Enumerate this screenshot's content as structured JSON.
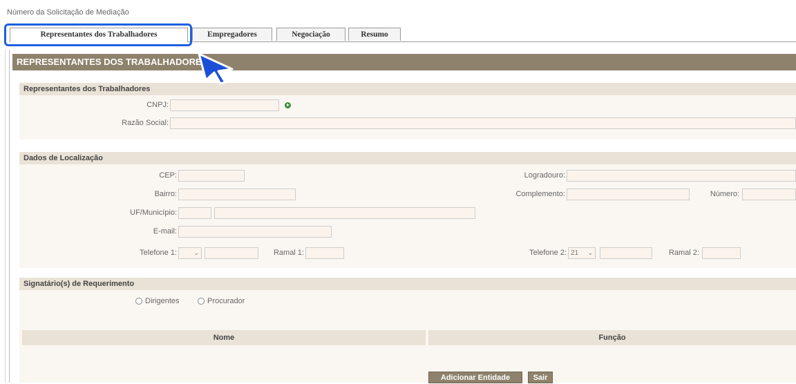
{
  "page": {
    "request_label": "Número da Solicitação de Mediação"
  },
  "tabs": [
    {
      "label": "Representantes dos Trabalhadores",
      "active": true
    },
    {
      "label": "Empregadores",
      "active": false
    },
    {
      "label": "Negociação",
      "active": false
    },
    {
      "label": "Resumo",
      "active": false
    }
  ],
  "panel": {
    "title": "REPRESENTANTES DOS TRABALHADORES"
  },
  "representantes": {
    "title": "Representantes dos Trabalhadores",
    "cnpj_label": "CNPJ:",
    "cnpj_value": "",
    "razao_label": "Razão Social:",
    "razao_value": ""
  },
  "localizacao": {
    "title": "Dados de Localização",
    "cep_label": "CEP:",
    "logradouro_label": "Logradouro:",
    "bairro_label": "Bairro:",
    "complemento_label": "Complemento:",
    "numero_label": "Número:",
    "uf_label": "UF/Município:",
    "email_label": "E-mail:",
    "telefone1_label": "Telefone 1:",
    "telefone1_ddd": "",
    "ramal1_label": "Ramal 1:",
    "telefone2_label": "Telefone 2:",
    "telefone2_ddd": "21",
    "ramal2_label": "Ramal 2:"
  },
  "signatarios": {
    "title": "Signatário(s) de Requerimento",
    "option_dirigentes": "Dirigentes",
    "option_procurador": "Procurador",
    "col_nome": "Nome",
    "col_funcao": "Função"
  },
  "actions": {
    "add_label": "Adicionar Entidade",
    "exit_label": "Sair"
  },
  "colors": {
    "header_bg": "#8e826c",
    "highlight": "#1c5fe0",
    "cursor": "#1c4fd8"
  },
  "icons": {
    "cnpj_lookup": "green-go-icon",
    "pointer": "mouse-cursor-icon"
  }
}
